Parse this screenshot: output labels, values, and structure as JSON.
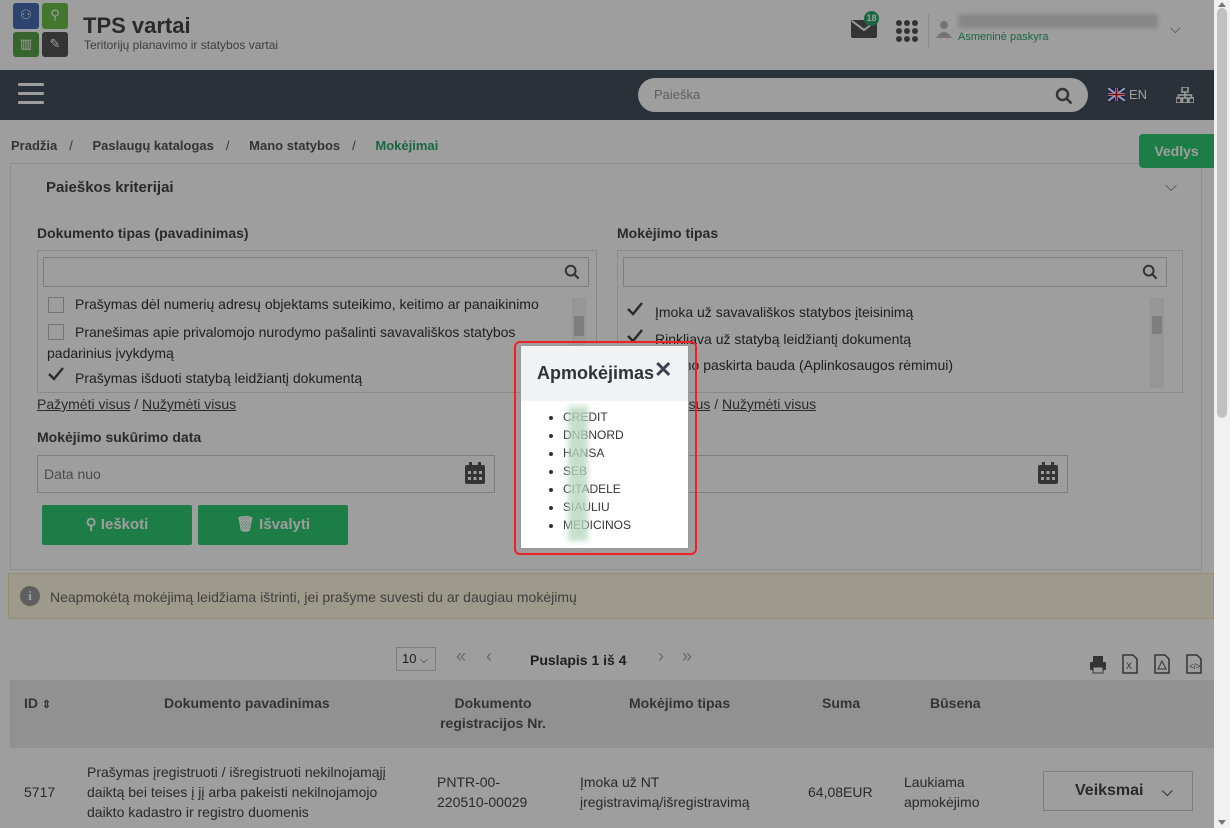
{
  "app": {
    "title": "TPS vartai",
    "subtitle": "Teritorijų planavimo ir statybos vartai"
  },
  "header": {
    "mail_count": "18",
    "account_label": "Asmeninė paskyra"
  },
  "navbar": {
    "search_placeholder": "Paieška",
    "language": "EN"
  },
  "breadcrumb": {
    "items": [
      "Pradžia",
      "Paslaugų katalogas",
      "Mano statybos"
    ],
    "active": "Mokėjimai",
    "separator": "/"
  },
  "guide_button": "Vedlys",
  "criteria": {
    "title": "Paieškos kriterijai",
    "doc_type_label": "Dokumento tipas (pavadinimas)",
    "doc_type_options": [
      {
        "text": "Prašymas dėl numerių adresų objektams suteikimo, keitimo ar panaikinimo",
        "checked": false
      },
      {
        "text": "Pranešimas apie privalomojo nurodymo pašalinti savavališkos statybos padarinius įvykdymą",
        "checked": false
      },
      {
        "text": "Prašymas išduoti statybą leidžiantį dokumentą",
        "checked": true
      }
    ],
    "payment_type_label": "Mokėjimo tipas",
    "payment_type_options": [
      {
        "text": "Įmoka už savavališkos statybos įteisinimą",
        "checked": true
      },
      {
        "text": "Rinkliava už statybą leidžiantį dokumentą",
        "checked": true
      },
      {
        "text": "Teismo paskirta bauda (Aplinkosaugos rėmimui)",
        "checked": false
      }
    ],
    "select_all": "Pažymėti visus",
    "deselect_all": "Nužymėti visus",
    "link_sep": "/",
    "date_label": "Mokėjimo sukūrimo data",
    "date_from_placeholder": "Data nuo",
    "search_button": "Ieškoti",
    "clear_button": "Išvalyti"
  },
  "info_text": "Neapmokėtą mokėjimą leidžiama ištrinti, jei prašyme suvesti du ar daugiau mokėjimų",
  "pagination": {
    "page_size": "10",
    "page_info": "Puslapis 1 iš 4"
  },
  "table": {
    "headers": {
      "id": "ID",
      "doc_name": "Dokumento pavadinimas",
      "doc_reg_1": "Dokumento",
      "doc_reg_2": "registracijos Nr.",
      "pay_type": "Mokėjimo tipas",
      "sum": "Suma",
      "status": "Būsena"
    },
    "rows": [
      {
        "id": "5717",
        "doc_name_1": "Prašymas įregistruoti / išregistruoti nekilnojamąjį",
        "doc_name_2": "daiktą bei teises į jį arba pakeisti nekilnojamojo",
        "doc_name_3": "daikto kadastro ir registro duomenis",
        "reg_1": "PNTR-00-",
        "reg_2": "220510-00029",
        "pay_1": "Įmoka už NT",
        "pay_2": "įregistravimą/išregistravimą",
        "sum": "64,08EUR",
        "status_1": "Laukiama",
        "status_2": "apmokėjimo",
        "actions": "Veiksmai"
      }
    ]
  },
  "modal": {
    "title": "Apmokėjimas",
    "banks": [
      "CREDIT",
      "DNBNORD",
      "HANSA",
      "SEB",
      "CITADELE",
      "SIAULIU",
      "MEDICINOS"
    ]
  },
  "colors": {
    "accent": "#2ecc71",
    "navbar": "#46505b",
    "highlight_border": "#ee2222"
  }
}
